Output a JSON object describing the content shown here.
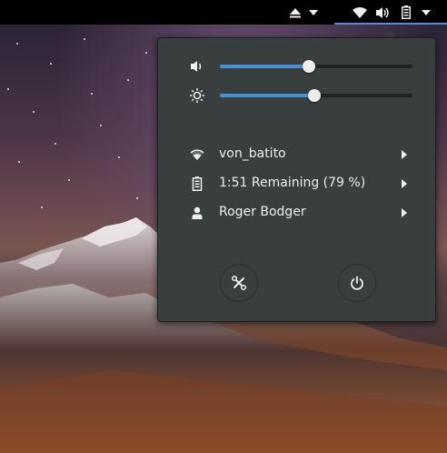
{
  "topbar": {
    "eject_icon": "media-eject-icon",
    "wifi_icon": "wifi-icon",
    "volume_icon": "volume-icon",
    "battery_icon": "battery-icon",
    "menu_arrow_icon": "chevron-down-icon"
  },
  "system_menu": {
    "volume": {
      "icon": "volume-low-icon",
      "level": 0.46
    },
    "brightness": {
      "icon": "brightness-icon",
      "level": 0.49
    },
    "items": [
      {
        "icon": "wifi-icon",
        "label": "von_batito"
      },
      {
        "icon": "battery-icon",
        "label": "1:51 Remaining (79 %)"
      },
      {
        "icon": "user-icon",
        "label": "Roger Bodger"
      }
    ],
    "buttons": [
      {
        "icon": "settings-icon"
      },
      {
        "icon": "power-icon"
      }
    ]
  },
  "colors": {
    "accent": "#4a90d9",
    "popover_bg": "#393f3f",
    "text": "#eeeeec"
  }
}
